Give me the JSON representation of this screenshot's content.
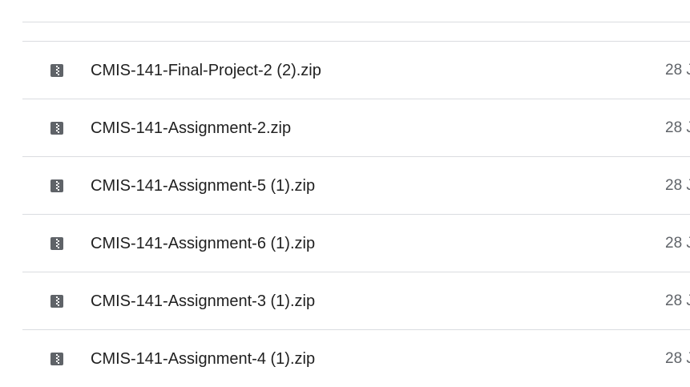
{
  "files": [
    {
      "name": "CMIS-141-Final-Project-2 (2).zip",
      "date": "28 J",
      "icon": "zip-file-icon"
    },
    {
      "name": "CMIS-141-Assignment-2.zip",
      "date": "28 J",
      "icon": "zip-file-icon"
    },
    {
      "name": "CMIS-141-Assignment-5 (1).zip",
      "date": "28 J",
      "icon": "zip-file-icon"
    },
    {
      "name": "CMIS-141-Assignment-6 (1).zip",
      "date": "28 J",
      "icon": "zip-file-icon"
    },
    {
      "name": "CMIS-141-Assignment-3 (1).zip",
      "date": "28 J",
      "icon": "zip-file-icon"
    },
    {
      "name": "CMIS-141-Assignment-4 (1).zip",
      "date": "28 J",
      "icon": "zip-file-icon"
    }
  ],
  "colors": {
    "divider": "#dadce0",
    "icon": "#5f6368",
    "text": "#1f1f1f",
    "date_text": "#5f6368"
  }
}
